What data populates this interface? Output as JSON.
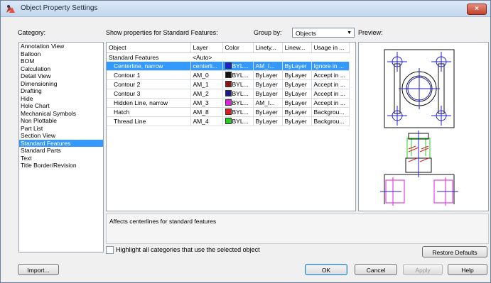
{
  "window": {
    "title": "Object Property Settings",
    "close_glyph": "×"
  },
  "labels": {
    "category": "Category:",
    "show_properties": "Show properties for Standard Features:",
    "group_by": "Group by:",
    "preview": "Preview:"
  },
  "categories": [
    "Annotation View",
    "Balloon",
    "BOM",
    "Calculation",
    "Detail View",
    "Dimensioning",
    "Drafting",
    "Hide",
    "Hole Chart",
    "Mechanical Symbols",
    "Non Plottable",
    "Part List",
    "Section View",
    "Standard Features",
    "Standard Parts",
    "Text",
    "Title Border/Revision"
  ],
  "selected_category": "Standard Features",
  "group_by": {
    "value": "Objects"
  },
  "table": {
    "headers": [
      "Object",
      "Layer",
      "Color",
      "Linety...",
      "Linew...",
      "Usage in ..."
    ],
    "group_row": {
      "object": "Standard Features",
      "layer": "<Auto>"
    },
    "rows": [
      {
        "object": "Centerline, narrow",
        "layer": "centerli...",
        "color": "BYL...",
        "swatch": "#1f1fd6",
        "linetype": "AM_I...",
        "lineweight": "ByLayer",
        "usage": "Ignore in ..."
      },
      {
        "object": "Contour 1",
        "layer": "AM_0",
        "color": "BYL...",
        "swatch": "#111111",
        "linetype": "ByLayer",
        "lineweight": "ByLayer",
        "usage": "Accept in ..."
      },
      {
        "object": "Contour 2",
        "layer": "AM_1",
        "color": "BYL...",
        "swatch": "#8a1616",
        "linetype": "ByLayer",
        "lineweight": "ByLayer",
        "usage": "Accept in ..."
      },
      {
        "object": "Contour 3",
        "layer": "AM_2",
        "color": "BYL...",
        "swatch": "#1a1a8c",
        "linetype": "ByLayer",
        "lineweight": "ByLayer",
        "usage": "Accept in ..."
      },
      {
        "object": "Hidden Line, narrow",
        "layer": "AM_3",
        "color": "BYL...",
        "swatch": "#e21ee2",
        "linetype": "AM_I...",
        "lineweight": "ByLayer",
        "usage": "Accept in ..."
      },
      {
        "object": "Hatch",
        "layer": "AM_8",
        "color": "BYL...",
        "swatch": "#e01c1c",
        "linetype": "ByLayer",
        "lineweight": "ByLayer",
        "usage": "Backgrou..."
      },
      {
        "object": "Thread Line",
        "layer": "AM_4",
        "color": "BYL...",
        "swatch": "#22d022",
        "linetype": "ByLayer",
        "lineweight": "ByLayer",
        "usage": "Backgrou..."
      }
    ]
  },
  "description": "Affects centerlines for standard features",
  "highlight_checkbox": {
    "label": "Highlight all categories that use the selected object",
    "checked": false
  },
  "buttons": {
    "restore": "Restore Defaults",
    "import": "Import...",
    "ok": "OK",
    "cancel": "Cancel",
    "apply": "Apply",
    "help": "Help"
  },
  "colors": {
    "selection": "#3399ff",
    "centerline": "#1f1fd6",
    "contour": "#111111",
    "hidden": "#e21ee2",
    "hatch": "#e01c1c",
    "thread": "#22d022"
  }
}
